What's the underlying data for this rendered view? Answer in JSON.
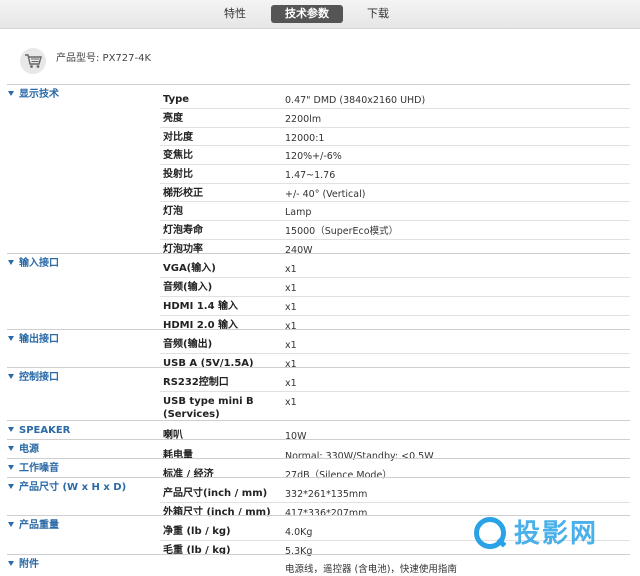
{
  "tabs": [
    {
      "label": "特性",
      "active": false
    },
    {
      "label": "技术参数",
      "active": true
    },
    {
      "label": "下载",
      "active": false
    }
  ],
  "model": {
    "label": "产品型号: PX727-4K"
  },
  "sections": [
    {
      "title": "显示技术",
      "rows": [
        {
          "k": "Type",
          "v": "0.47\" DMD (3840x2160 UHD)"
        },
        {
          "k": "亮度",
          "v": "2200lm"
        },
        {
          "k": "对比度",
          "v": "12000:1"
        },
        {
          "k": "变焦比",
          "v": "120%+/-6%"
        },
        {
          "k": "投射比",
          "v": "1.47~1.76"
        },
        {
          "k": "梯形校正",
          "v": "+/- 40° (Vertical)"
        },
        {
          "k": "灯泡",
          "v": "Lamp"
        },
        {
          "k": "灯泡寿命",
          "v": "15000（SuperEco模式）"
        },
        {
          "k": "灯泡功率",
          "v": "240W"
        }
      ]
    },
    {
      "title": "输入接口",
      "rows": [
        {
          "k": "VGA(输入)",
          "v": "x1"
        },
        {
          "k": "音频(输入)",
          "v": "x1"
        },
        {
          "k": "HDMI 1.4 输入",
          "v": "x1"
        },
        {
          "k": "HDMI 2.0 输入",
          "v": "x1"
        }
      ]
    },
    {
      "title": "输出接口",
      "rows": [
        {
          "k": "音频(输出)",
          "v": "x1"
        },
        {
          "k": "USB A (5V/1.5A)",
          "v": "x1"
        }
      ]
    },
    {
      "title": "控制接口",
      "rows": [
        {
          "k": "RS232控制口",
          "v": "x1"
        },
        {
          "k": "USB type mini B",
          "k2": "(Services)",
          "v": "x1"
        }
      ]
    },
    {
      "title": "SPEAKER",
      "rows": [
        {
          "k": "喇叭",
          "v": "10W"
        }
      ]
    },
    {
      "title": "电源",
      "rows": [
        {
          "k": "耗电量",
          "v": "Normal: 330W/Standby: <0.5W"
        }
      ]
    },
    {
      "title": "工作噪音",
      "rows": [
        {
          "k": "标准 / 经济",
          "v": "27dB（Silence Mode）"
        }
      ]
    },
    {
      "title": "产品尺寸 (W x H x D)",
      "rows": [
        {
          "k": "产品尺寸(inch / mm)",
          "v": "332*261*135mm"
        },
        {
          "k": "外箱尺寸 (inch / mm)",
          "v": "417*336*207mm"
        }
      ]
    },
    {
      "title": "产品重量",
      "rows": [
        {
          "k": "净重 (lb / kg)",
          "v": "4.0Kg"
        },
        {
          "k": "毛重 (lb / kg)",
          "v": "5.3Kg"
        }
      ]
    },
    {
      "title": "附件",
      "rows": [
        {
          "k": "",
          "v": "电源线，遥控器 (含电池)，快速使用指南"
        }
      ]
    }
  ],
  "watermark": {
    "text": "投影网"
  },
  "colors": {
    "accent": "#2b6aa6",
    "tab_active_bg": "#555555",
    "watermark": "#2aa3e6"
  },
  "icons": {
    "cart": "shopping-cart-icon",
    "section": "triangle-down-icon"
  }
}
